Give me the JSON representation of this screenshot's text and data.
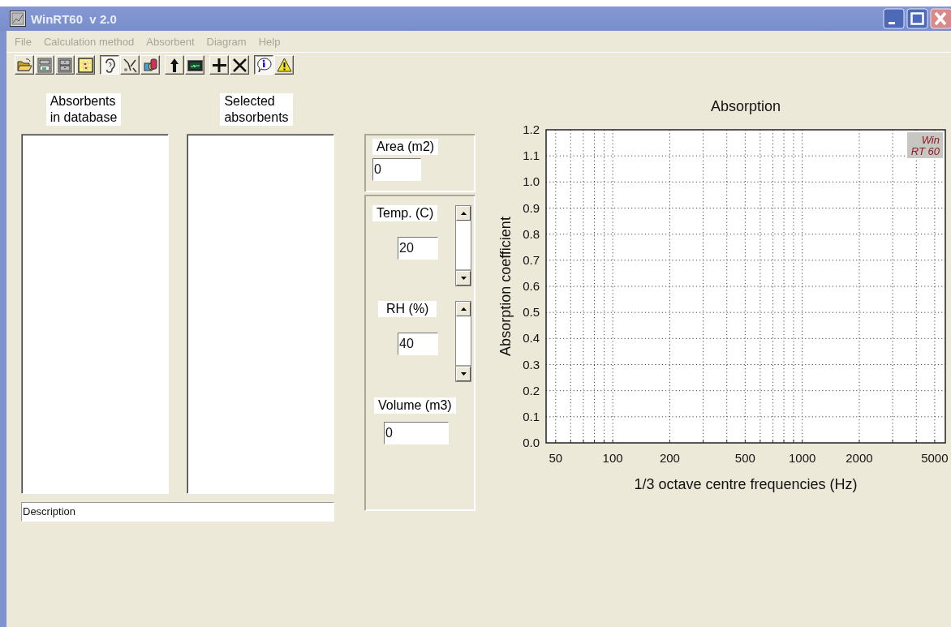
{
  "window": {
    "title": "WinRT60  v 2.0"
  },
  "menu": [
    {
      "label": "File",
      "disabled": true
    },
    {
      "label": "Calculation method",
      "disabled": true
    },
    {
      "label": "Absorbent",
      "disabled": true
    },
    {
      "label": "Diagram",
      "disabled": true
    },
    {
      "label": "Help",
      "disabled": true
    }
  ],
  "toolbar": [
    [
      {
        "kind": "open",
        "pressed": false
      },
      {
        "kind": "cabinet-photo",
        "pressed": false
      },
      {
        "kind": "cabinet",
        "pressed": false
      },
      {
        "kind": "grid",
        "pressed": false
      }
    ],
    [
      {
        "kind": "ear",
        "pressed": true
      },
      {
        "kind": "tool",
        "pressed": false
      },
      {
        "kind": "shapes",
        "pressed": false
      }
    ],
    [
      {
        "kind": "arrow",
        "pressed": false
      },
      {
        "kind": "monitor",
        "pressed": false
      }
    ],
    [
      {
        "kind": "plus",
        "pressed": false
      },
      {
        "kind": "cross",
        "pressed": false
      }
    ],
    [
      {
        "kind": "info",
        "pressed": true
      },
      {
        "kind": "warning",
        "pressed": false
      }
    ]
  ],
  "lists": [
    {
      "heading": "Absorbents\nin database"
    },
    {
      "heading": "Selected\nabsorbents"
    }
  ],
  "description": {
    "value": "Description"
  },
  "area": {
    "label": "Area (m2)",
    "value": "0"
  },
  "temperature": {
    "label": "Temp. (C)",
    "value": "20"
  },
  "humidity": {
    "label": "RH (%)",
    "value": "40"
  },
  "volume": {
    "label": "Volume (m3)",
    "value": "0"
  },
  "chart": {
    "logo": [
      "Win",
      "RT 60"
    ],
    "title": "Absorption",
    "xlabel": "1/3 octave centre frequencies (Hz)",
    "ylabel": "Absorption coefficient",
    "x_tick_labels": [
      "50",
      "100",
      "200",
      "500",
      "1000",
      "2000",
      "5000"
    ],
    "y_tick_labels": [
      "1.2",
      "1.1",
      "1.0",
      "0.9",
      "0.8",
      "0.7",
      "0.6",
      "0.5",
      "0.4",
      "0.3",
      "0.2",
      "0.1",
      "0.0"
    ]
  }
}
